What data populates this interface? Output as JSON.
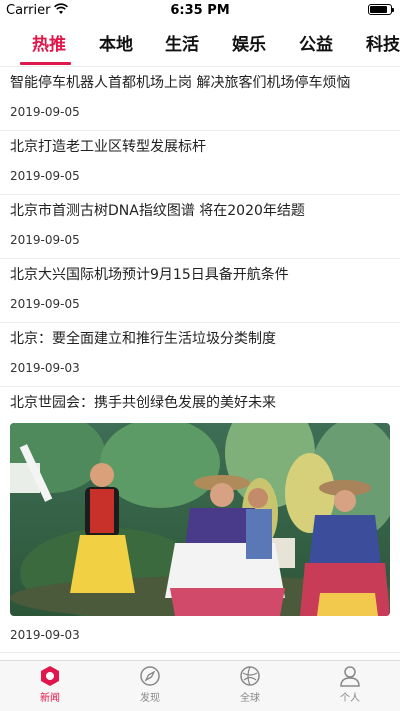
{
  "status_bar": {
    "carrier": "Carrier",
    "time": "6:35 PM",
    "battery_level": 0.85
  },
  "tabs": [
    {
      "label": "热推",
      "active": true
    },
    {
      "label": "本地",
      "active": false
    },
    {
      "label": "生活",
      "active": false
    },
    {
      "label": "娱乐",
      "active": false
    },
    {
      "label": "公益",
      "active": false
    },
    {
      "label": "科技",
      "active": false
    }
  ],
  "news": [
    {
      "title": "智能停车机器人首都机场上岗 解决旅客们机场停车烦恼",
      "date": "2019-09-05"
    },
    {
      "title": "北京打造老工业区转型发展标杆",
      "date": "2019-09-05"
    },
    {
      "title": "北京市首测古树DNA指纹图谱 将在2020年结题",
      "date": "2019-09-05"
    },
    {
      "title": "北京大兴国际机场预计9月15日具备开航条件",
      "date": "2019-09-05"
    },
    {
      "title": "北京：要全面建立和推行生活垃圾分类制度",
      "date": "2019-09-03"
    },
    {
      "title": "北京世园会：携手共创绿色发展的美好未来",
      "date": "2019-09-03",
      "has_image": true
    }
  ],
  "bottom_nav": [
    {
      "label": "新闻",
      "icon": "news-icon",
      "active": true
    },
    {
      "label": "发现",
      "icon": "compass-icon",
      "active": false
    },
    {
      "label": "全球",
      "icon": "globe-icon",
      "active": false
    },
    {
      "label": "个人",
      "icon": "person-icon",
      "active": false
    }
  ],
  "colors": {
    "accent": "#e0174b",
    "inactive": "#888888"
  }
}
